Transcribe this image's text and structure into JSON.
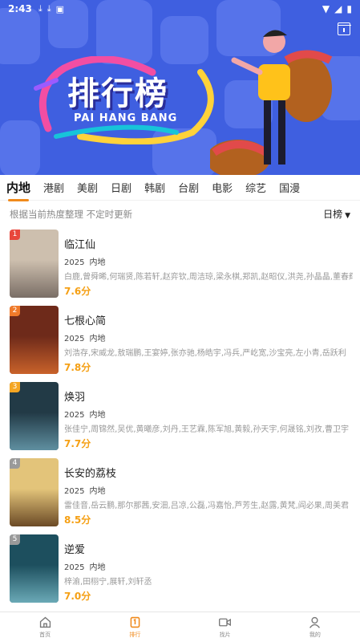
{
  "status_bar": {
    "time": "2:43",
    "left_icons": [
      "download-icon",
      "download-icon",
      "a-icon"
    ],
    "right_icons": [
      "wifi-icon",
      "signal-icon",
      "battery-icon"
    ]
  },
  "banner": {
    "title_cn": "排行榜",
    "title_en": "PAI HANG BANG",
    "bg_color": "#3f5fe0"
  },
  "tabs": [
    {
      "label": "内地",
      "active": true
    },
    {
      "label": "港剧"
    },
    {
      "label": "美剧"
    },
    {
      "label": "日剧"
    },
    {
      "label": "韩剧"
    },
    {
      "label": "台剧"
    },
    {
      "label": "电影"
    },
    {
      "label": "综艺"
    },
    {
      "label": "国漫"
    }
  ],
  "subheader": {
    "note": "根据当前热度整理 不定时更新",
    "period": "日榜"
  },
  "items": [
    {
      "rank": "1",
      "title": "临江仙",
      "year": "2025",
      "region": "内地",
      "cast": "白鹿,曾舜晞,何瑞贤,陈若轩,赵弈钦,周洁琼,梁永棋,郑凯,赵昭仪,洪尧,孙晶晶,董春辉",
      "score": "7.6分",
      "rank_color": "#e8473c"
    },
    {
      "rank": "2",
      "title": "七根心简",
      "year": "2025",
      "region": "内地",
      "cast": "刘浩存,宋威龙,敖瑞鹏,王宴婷,张亦驰,杨皓宇,冯兵,严屹宽,沙宝亮,左小青,岳跃利",
      "score": "7.8分",
      "rank_color": "#f07a2a"
    },
    {
      "rank": "3",
      "title": "焕羽",
      "year": "2025",
      "region": "内地",
      "cast": "张佳宁,周锦然,吴优,黄曦彦,刘丹,王艺霖,陈军旭,黄毅,孙天宇,何晟铭,刘孜,曹卫宇",
      "score": "7.7分",
      "rank_color": "#f5a623"
    },
    {
      "rank": "4",
      "title": "长安的荔枝",
      "year": "2025",
      "region": "内地",
      "cast": "雷佳音,岳云鹏,那尔那茜,安沺,吕凉,公磊,冯嘉怡,芦芳生,赵露,黄梵,阎必果,周美君",
      "score": "8.5分",
      "rank_color": "#9a9a9a"
    },
    {
      "rank": "5",
      "title": "逆爱",
      "year": "2025",
      "region": "内地",
      "cast": "梓渝,田栩宁,展轩,刘轩丞",
      "score": "7.0分",
      "rank_color": "#9a9a9a"
    }
  ],
  "bottom_nav": [
    {
      "label": "首页",
      "icon": "home-icon"
    },
    {
      "label": "排行",
      "icon": "ranking-icon",
      "active": true
    },
    {
      "label": "找片",
      "icon": "video-icon"
    },
    {
      "label": "我的",
      "icon": "user-icon"
    }
  ]
}
